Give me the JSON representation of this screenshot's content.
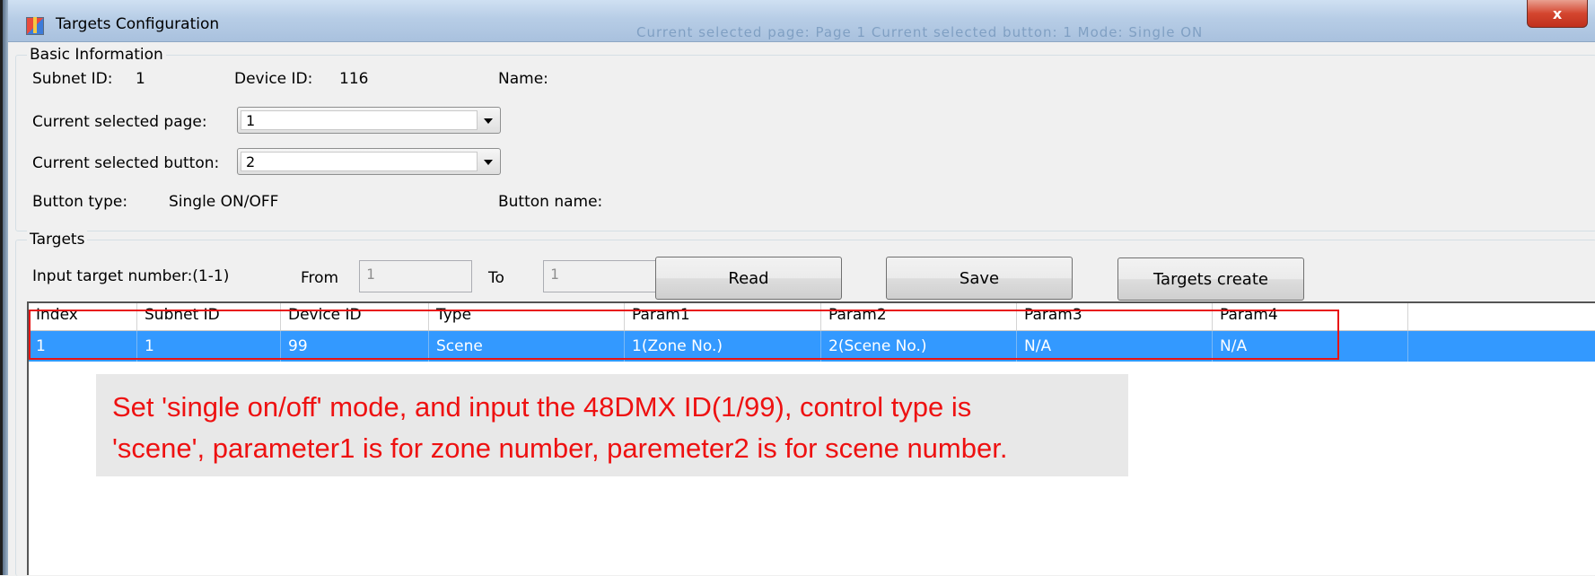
{
  "window": {
    "title": "Targets Configuration",
    "close_label": "x",
    "ghost_title": "Current selected page:   Page 1   Current selected button:  1       Mode:   Single ON"
  },
  "basic_info": {
    "title": "Basic Information",
    "subnet_label": "Subnet ID:",
    "subnet_value": "1",
    "device_label": "Device ID:",
    "device_value": "116",
    "name_label": "Name:",
    "page_label": "Current selected page:",
    "page_value": "1",
    "button_label": "Current selected button:",
    "button_value": "2",
    "button_type_label": "Button type:",
    "button_type_value": "Single ON/OFF",
    "button_name_label": "Button name:"
  },
  "targets": {
    "title": "Targets",
    "input_label": "Input target number:(1-1)",
    "from_label": "From",
    "from_value": "1",
    "to_label": "To",
    "to_value": "1",
    "read_label": "Read",
    "save_label": "Save",
    "create_label": "Targets create"
  },
  "table": {
    "columns": [
      "Index",
      "Subnet ID",
      "Device ID",
      "Type",
      "Param1",
      "Param2",
      "Param3",
      "Param4"
    ],
    "rows": [
      [
        "1",
        "1",
        "99",
        "Scene",
        "1(Zone No.)",
        "2(Scene No.)",
        "N/A",
        "N/A"
      ]
    ]
  },
  "note": {
    "line1": "Set 'single on/off' mode, and input the 48DMX ID(1/99), control type is",
    "line2": "'scene', parameter1 is for zone number, paremeter2 is for scene number."
  },
  "colors": {
    "selection": "#3399ff",
    "highlight_border": "#e81414",
    "note_text": "#ee1111"
  }
}
